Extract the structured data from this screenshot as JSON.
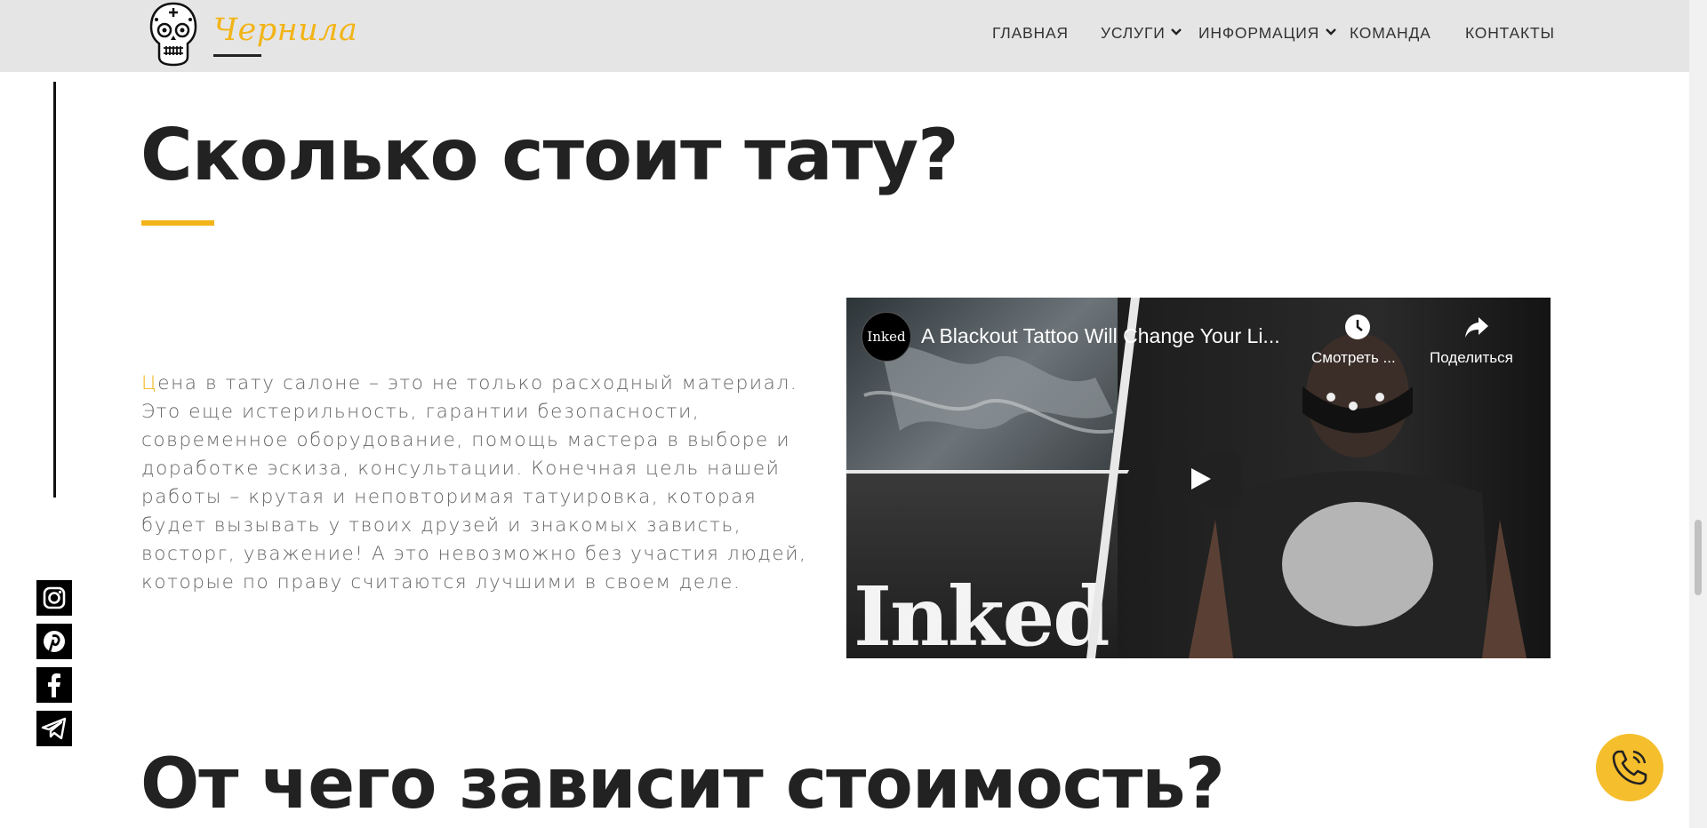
{
  "brand": {
    "name": "Чернила",
    "accent": "#f2b418"
  },
  "nav": {
    "items": [
      {
        "label": "ГЛАВНАЯ",
        "has_dropdown": false
      },
      {
        "label": "УСЛУГИ",
        "has_dropdown": true
      },
      {
        "label": "ИНФОРМАЦИЯ",
        "has_dropdown": true
      },
      {
        "label": "КОМАНДА",
        "has_dropdown": false
      },
      {
        "label": "КОНТАКТЫ",
        "has_dropdown": false
      }
    ]
  },
  "section1": {
    "title": "Сколько стоит тату?",
    "paragraph_first_letter": "Ц",
    "paragraph_rest": "ена в тату салоне – это не только расходный материал. Это еще истерильность, гарантии безопасности, современное оборудование, помощь мастера в выборе и доработке эскиза, консультации. Конечная цель нашей работы – крутая и неповторимая татуировка, которая будет вызывать у твоих друзей и знакомых зависть, восторг, уважение! А это невозможно без участия людей, которые по праву считаются лучшими в своем деле."
  },
  "video": {
    "channel_badge": "Inked",
    "title": "A Blackout Tattoo Will Change Your Li...",
    "watch_later_label": "Смотреть ...",
    "share_label": "Поделиться",
    "thumbnail_brand": "Inked"
  },
  "section2": {
    "title": "От чего зависит стоимость?"
  },
  "social": [
    "instagram-icon",
    "pinterest-icon",
    "facebook-icon",
    "telegram-icon"
  ],
  "call_button": {
    "icon": "phone-icon",
    "color": "#f5be2c"
  }
}
